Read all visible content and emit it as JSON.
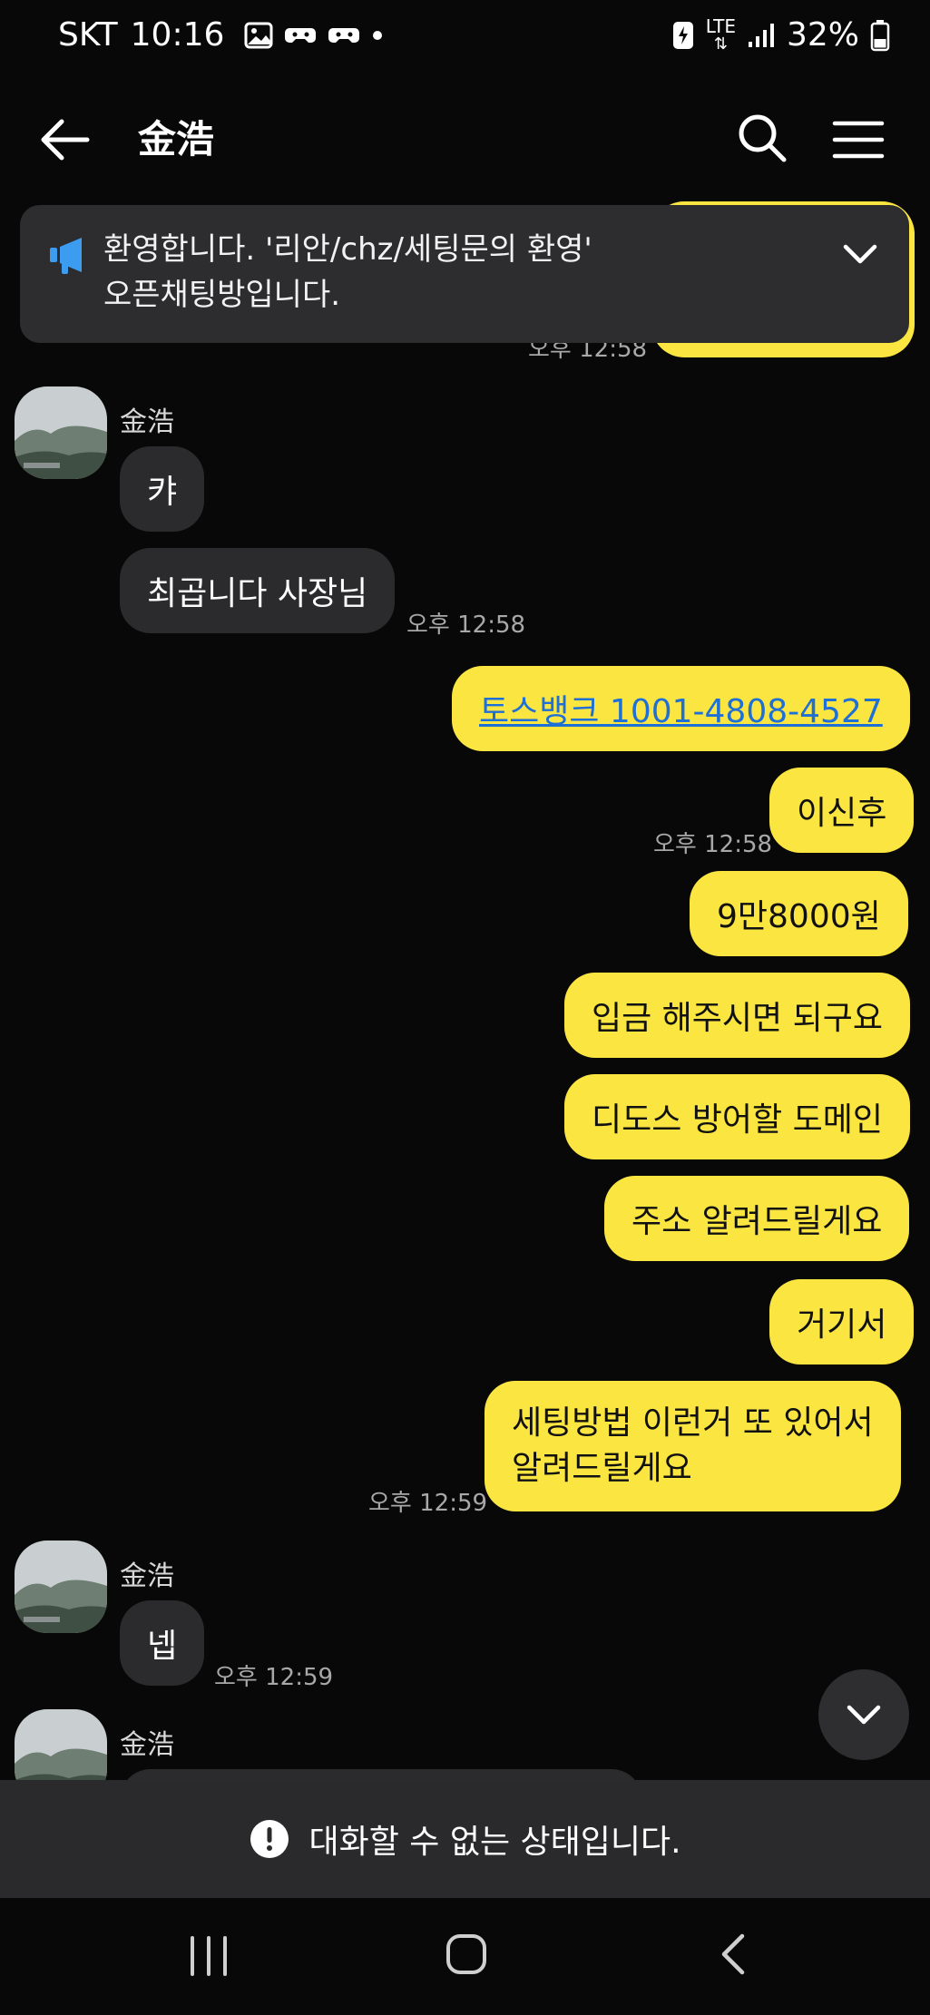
{
  "status_bar": {
    "carrier": "SKT",
    "time": "10:16",
    "network": "LTE",
    "battery": "32%"
  },
  "header": {
    "title": "金浩"
  },
  "notice": {
    "line1": "환영합니다. '리안/chz/세팅문의 환영'",
    "line2": "오픈채팅방입니다."
  },
  "messages": {
    "top_partial_time": "오후 12:58",
    "group1": {
      "sender": "金浩",
      "msg1": "캬",
      "msg2": "최곱니다 사장님",
      "time": "오후 12:58"
    },
    "outgoing": {
      "link": "토스뱅크 1001-4808-4527",
      "msg2": "이신후",
      "time1": "오후 12:58",
      "msg3": "9만8000원",
      "msg4": "입금 해주시면 되구요",
      "msg5": "디도스 방어할 도메인",
      "msg6": "주소 알려드릴게요",
      "msg7": "거기서",
      "msg8_line1": "세팅방법 이런거 또 있어서",
      "msg8_line2": "알려드릴게요",
      "time2": "오후 12:59"
    },
    "group2": {
      "sender": "金浩",
      "msg1": "넵",
      "time": "오후 12:59"
    },
    "group3": {
      "sender": "金浩"
    }
  },
  "disabled_banner": {
    "text": "대화할 수 없는 상태입니다."
  },
  "colors": {
    "background": "#080808",
    "outgoing_bubble": "#fbe540",
    "incoming_bubble": "#2b2b2d",
    "notice_icon": "#3b9cf0",
    "link": "#1e6fd6"
  }
}
